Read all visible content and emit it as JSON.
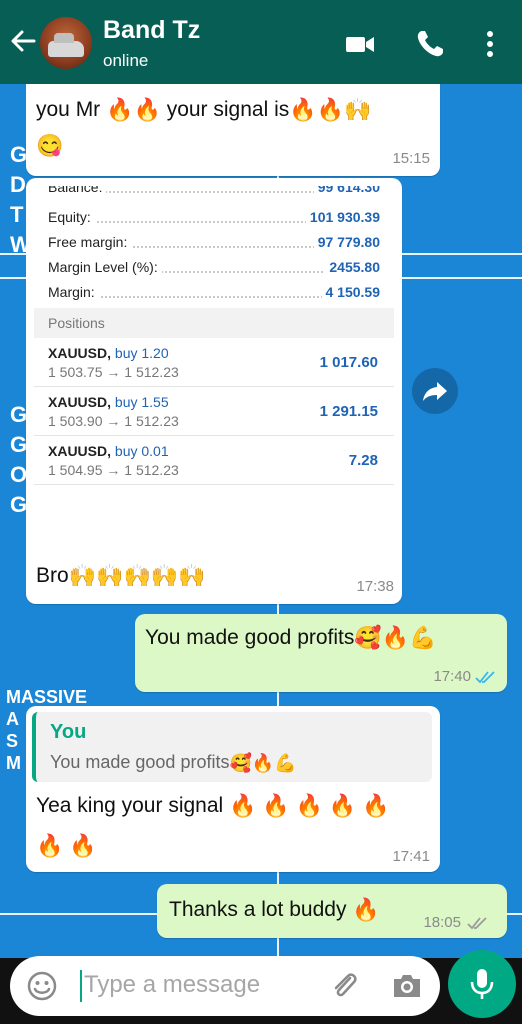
{
  "header": {
    "contact_name": "Band Tz",
    "status": "online",
    "colors": {
      "bar": "#075e54",
      "text": "#ffffff"
    }
  },
  "messages": {
    "m1": {
      "text": "you Mr",
      "text_mid": "your signal is",
      "time": "15:15"
    },
    "m2": {
      "account": [
        {
          "label": "Balance:",
          "value": "99 614.30"
        },
        {
          "label": "Equity:",
          "value": "101 930.39"
        },
        {
          "label": "Free margin:",
          "value": "97 779.80"
        },
        {
          "label": "Margin Level (%):",
          "value": "2455.80"
        },
        {
          "label": "Margin:",
          "value": "4 150.59"
        }
      ],
      "positions_header": "Positions",
      "positions": [
        {
          "symbol": "XAUUSD,",
          "direction": "buy 1.20",
          "path": "1 503.75 → 1 512.23",
          "profit": "1 017.60"
        },
        {
          "symbol": "XAUUSD,",
          "direction": "buy 1.55",
          "path": "1 503.90 → 1 512.23",
          "profit": "1 291.15"
        },
        {
          "symbol": "XAUUSD,",
          "direction": "buy 0.01",
          "path": "1 504.95 → 1 512.23",
          "profit": "7.28"
        }
      ],
      "caption": "Bro",
      "time": "17:38"
    },
    "m3": {
      "text": "You made good profits",
      "time": "17:40"
    },
    "m4": {
      "quote_name": "You",
      "quote_text": "You made good profits",
      "text": "Yea king your signal",
      "time": "17:41"
    },
    "m5": {
      "text": "Thanks a lot buddy",
      "time": "18:05"
    }
  },
  "wallpaper": {
    "letters_top": [
      "G",
      "D",
      "T",
      "W"
    ],
    "letters_mid": [
      "G",
      "G",
      "O",
      "G"
    ],
    "massive": [
      "MASSIVE",
      "A",
      "S",
      "M"
    ]
  },
  "input": {
    "placeholder": "Type a message"
  },
  "icons": {
    "back": "back-arrow-icon",
    "video": "video-call-icon",
    "call": "phone-icon",
    "menu": "more-options-icon",
    "forward": "forward-icon",
    "emoji": "emoji-icon",
    "attach": "paperclip-icon",
    "camera": "camera-icon",
    "mic": "microphone-icon"
  },
  "colors": {
    "outgoing_bubble": "#dcf8c6",
    "incoming_bubble": "#ffffff",
    "accent": "#00a884",
    "read_ticks": "#34b7f1",
    "value_blue": "#1f63b4"
  }
}
